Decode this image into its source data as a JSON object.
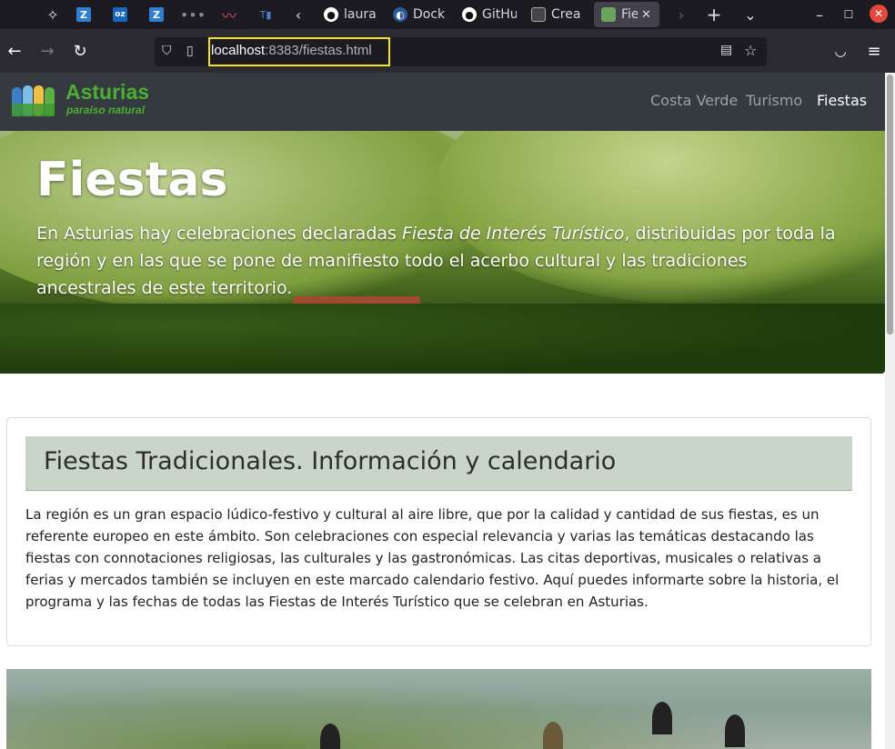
{
  "browser": {
    "tabs": [
      {
        "label": "laura",
        "favicon": "github-icon"
      },
      {
        "label": "Dock",
        "favicon": "docker-icon"
      },
      {
        "label": "GitHu",
        "favicon": "github-icon"
      },
      {
        "label": "Crea",
        "favicon": "page-icon"
      },
      {
        "label": "Fie",
        "favicon": "site-icon",
        "active": true
      }
    ],
    "url_host": "localhost",
    "url_path": ":8383/fiestas.html"
  },
  "site": {
    "logo_title": "Asturias",
    "logo_subtitle": "paraíso natural",
    "nav": [
      {
        "label": "Costa Verde"
      },
      {
        "label": "Turismo"
      },
      {
        "label": "Fiestas",
        "active": true
      }
    ]
  },
  "hero": {
    "title": "Fiestas",
    "text_before": "En Asturias hay celebraciones declaradas ",
    "text_italic": "Fiesta de Interés Turístico",
    "text_after": ", distribuidas por toda la región y en las que se pone de manifiesto todo el acerbo cultural y las tradiciones ancestrales de este territorio."
  },
  "card": {
    "title": "Fiestas Tradicionales. Información y calendario",
    "body": "La región es un gran espacio lúdico-festivo y cultural al aire libre, que por la calidad y cantidad de sus fiestas, es un referente europeo en este ámbito. Son celebraciones con especial relevancia y varias las temáticas destacando las fiestas con connotaciones religiosas, las culturales y las gastronómicas. Las citas deportivas, musicales o relativas a ferias y mercados también se incluyen en este marcado calendario festivo. Aquí puedes informarte sobre la historia, el programa y las fechas de todas las Fiestas de Interés Turístico que se celebran en Asturias."
  },
  "colors": {
    "accent_green": "#4caf2f",
    "header_bg": "#343a40",
    "card_head_bg": "#cad5c9"
  }
}
